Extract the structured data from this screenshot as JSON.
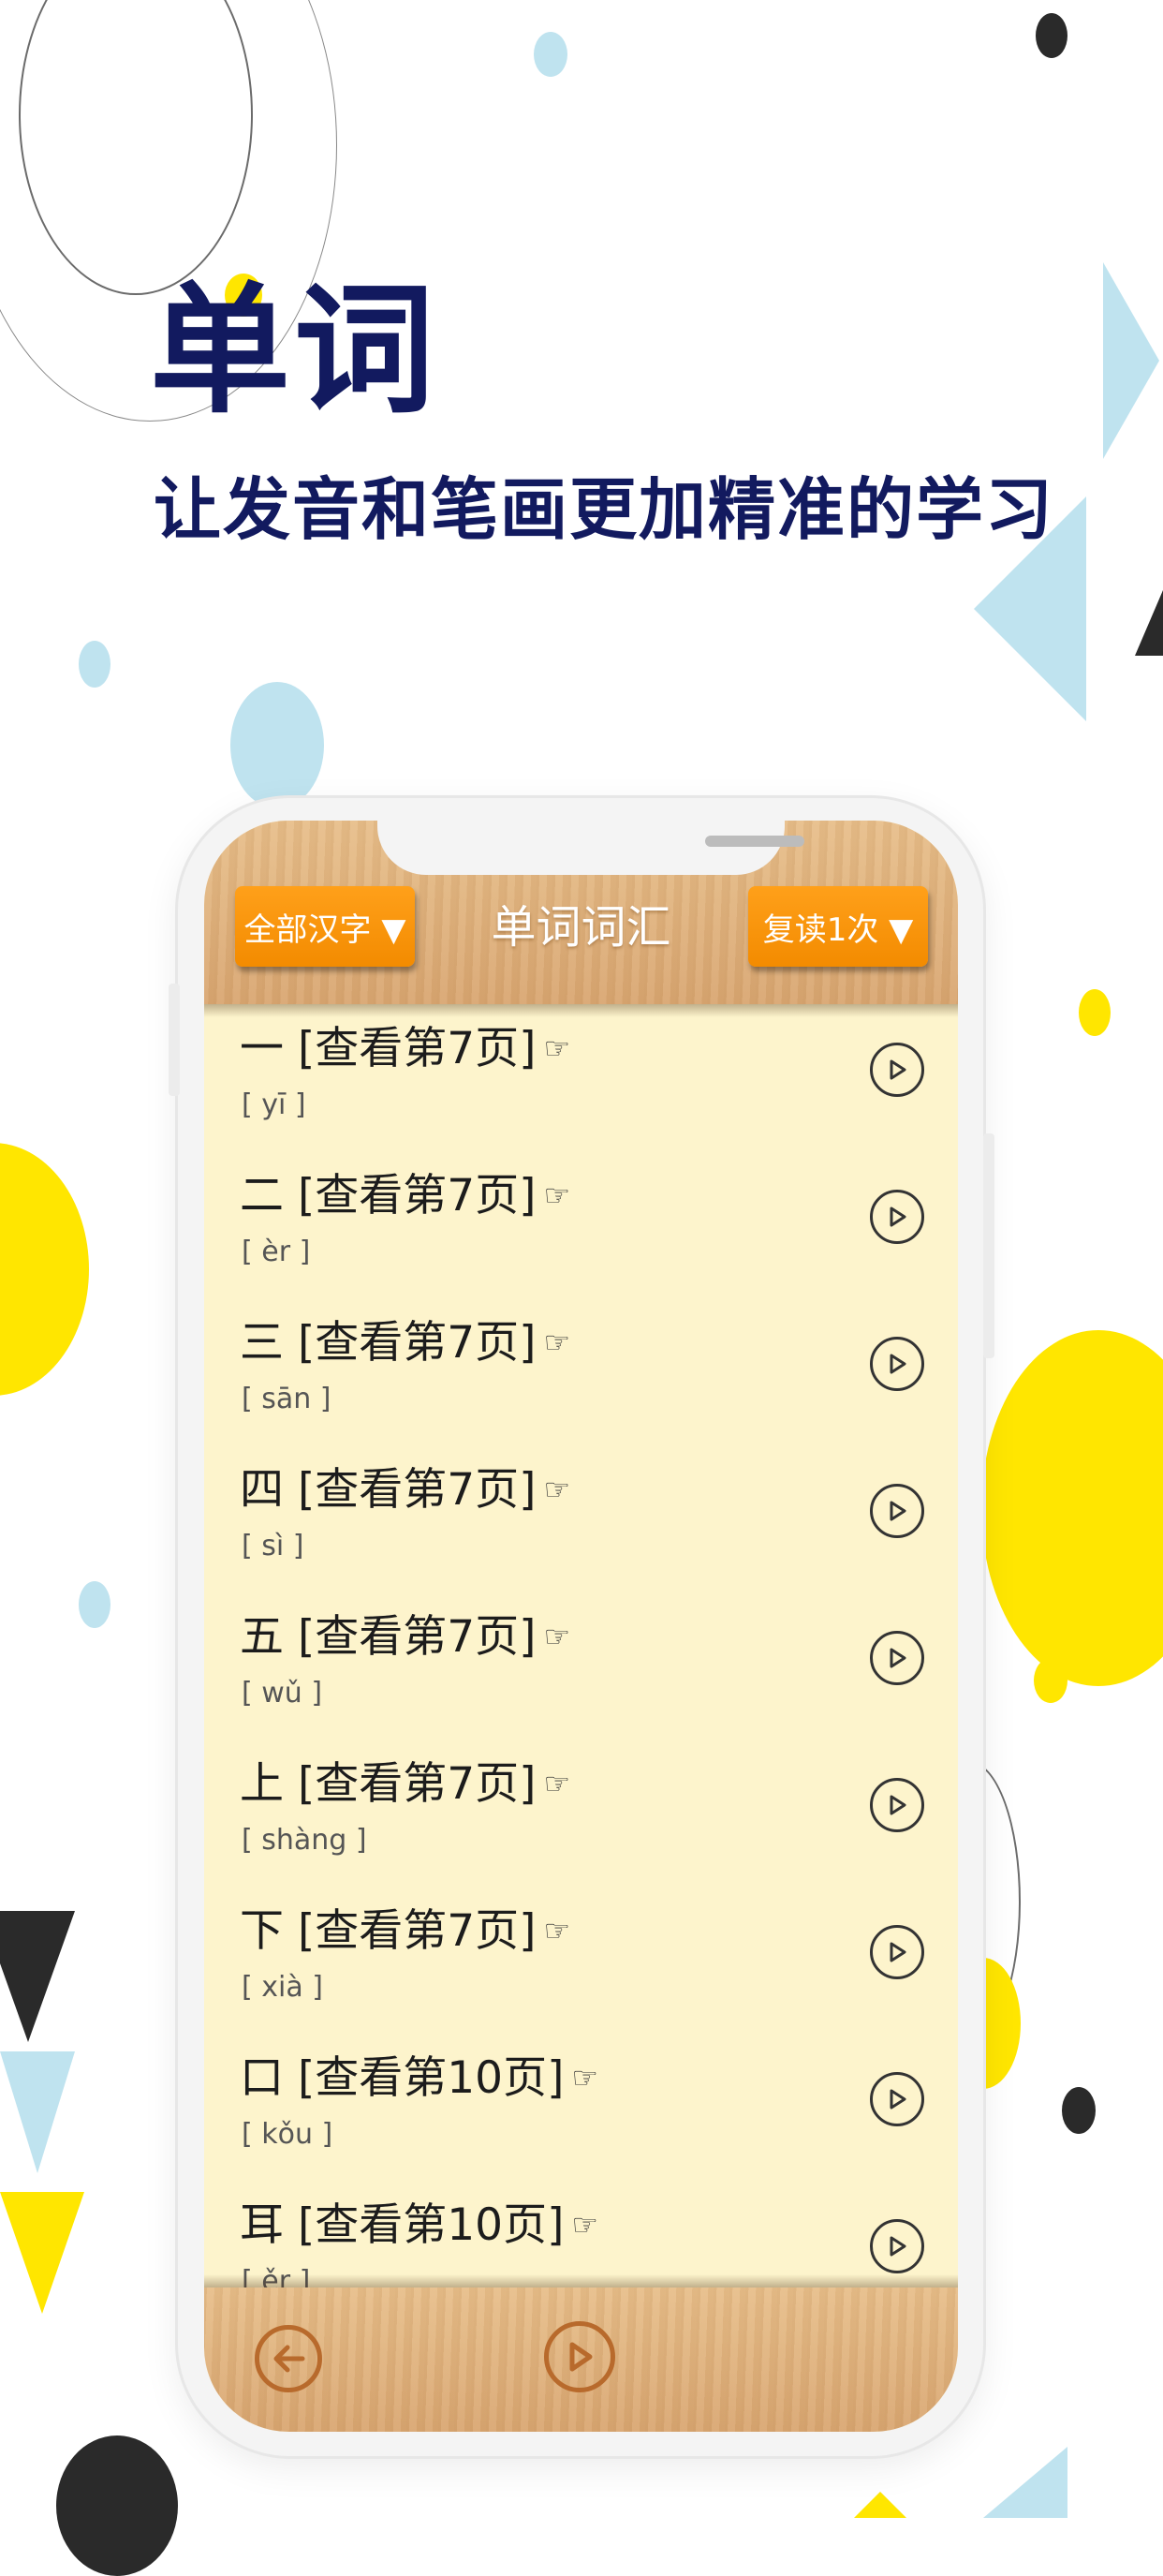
{
  "promo": {
    "title": "单词",
    "subtitle": "让发音和笔画更加精准的学习"
  },
  "header": {
    "left_button": "全部汉字 ▼",
    "title": "单词词汇",
    "right_button": "复读1次 ▼"
  },
  "words": [
    {
      "label": "一 [查看第7页]",
      "pinyin": "[ yī ]"
    },
    {
      "label": "二 [查看第7页]",
      "pinyin": "[ èr ]"
    },
    {
      "label": "三 [查看第7页]",
      "pinyin": "[ sān ]"
    },
    {
      "label": "四 [查看第7页]",
      "pinyin": "[ sì ]"
    },
    {
      "label": "五 [查看第7页]",
      "pinyin": "[ wǔ ]"
    },
    {
      "label": "上 [查看第7页]",
      "pinyin": "[ shàng ]"
    },
    {
      "label": "下 [查看第7页]",
      "pinyin": "[ xià ]"
    },
    {
      "label": "口 [查看第10页]",
      "pinyin": "[ kǒu ]"
    },
    {
      "label": "耳 [查看第10页]",
      "pinyin": "[ ěr ]"
    }
  ],
  "icons": {
    "hand": "pointing-hand-icon",
    "play": "play-circle-icon",
    "back": "back-arrow-icon"
  },
  "colors": {
    "headline": "#121a5f",
    "accent_orange": "#f38b00",
    "list_background": "#fdf4cc",
    "wood": "#deae78",
    "yellow_deco": "#ffe600",
    "blue_deco": "#bfe3ef"
  }
}
